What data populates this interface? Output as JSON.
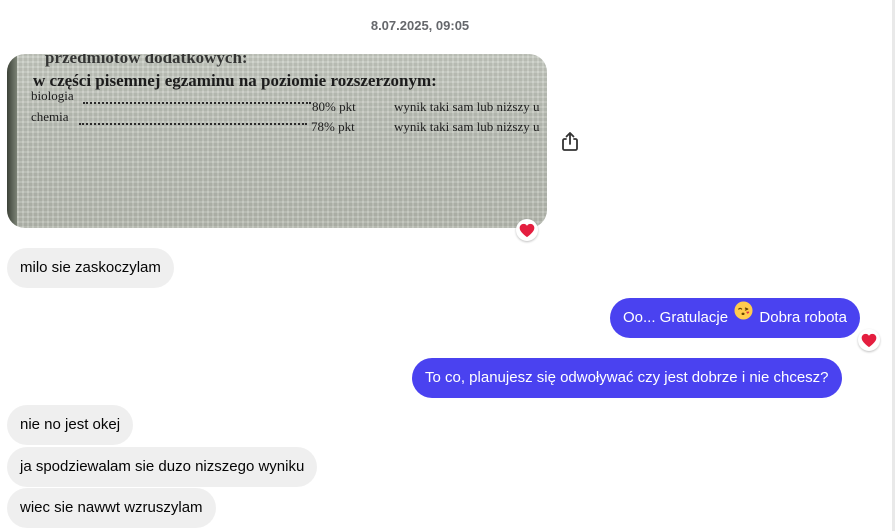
{
  "timestamp": "8.07.2025, 09:05",
  "photo": {
    "heading_top": "przedmiotów dodatkowych:",
    "heading": "w części pisemnej egzaminu na poziomie rozszerzonym:",
    "rows": [
      {
        "subject": "biologia",
        "score": "80% pkt",
        "result": "wynik taki sam lub niższy u"
      },
      {
        "subject": "chemia",
        "score": "78% pkt",
        "result": "wynik taki sam lub niższy u"
      }
    ],
    "reaction": "heart-icon"
  },
  "messages": [
    {
      "side": "in",
      "text": "milo sie zaskoczylam"
    },
    {
      "side": "out",
      "text_before": "Oo... Gratulacje",
      "emoji": "kissing-face-icon",
      "text_after": "Dobra robota",
      "reaction": "heart-icon"
    },
    {
      "side": "out",
      "text": "To co, planujesz się odwoływać czy jest dobrze i nie chcesz?"
    },
    {
      "side": "in",
      "text": "nie no jest okej"
    },
    {
      "side": "in",
      "text": "ja spodziewalam sie duzo nizszego wyniku"
    },
    {
      "side": "in",
      "text": "wiec sie nawwt wzruszylam"
    }
  ],
  "colors": {
    "outgoing_bubble": "#4a42f0",
    "incoming_bubble": "#efefef",
    "reaction_heart": "#e41e3f"
  }
}
